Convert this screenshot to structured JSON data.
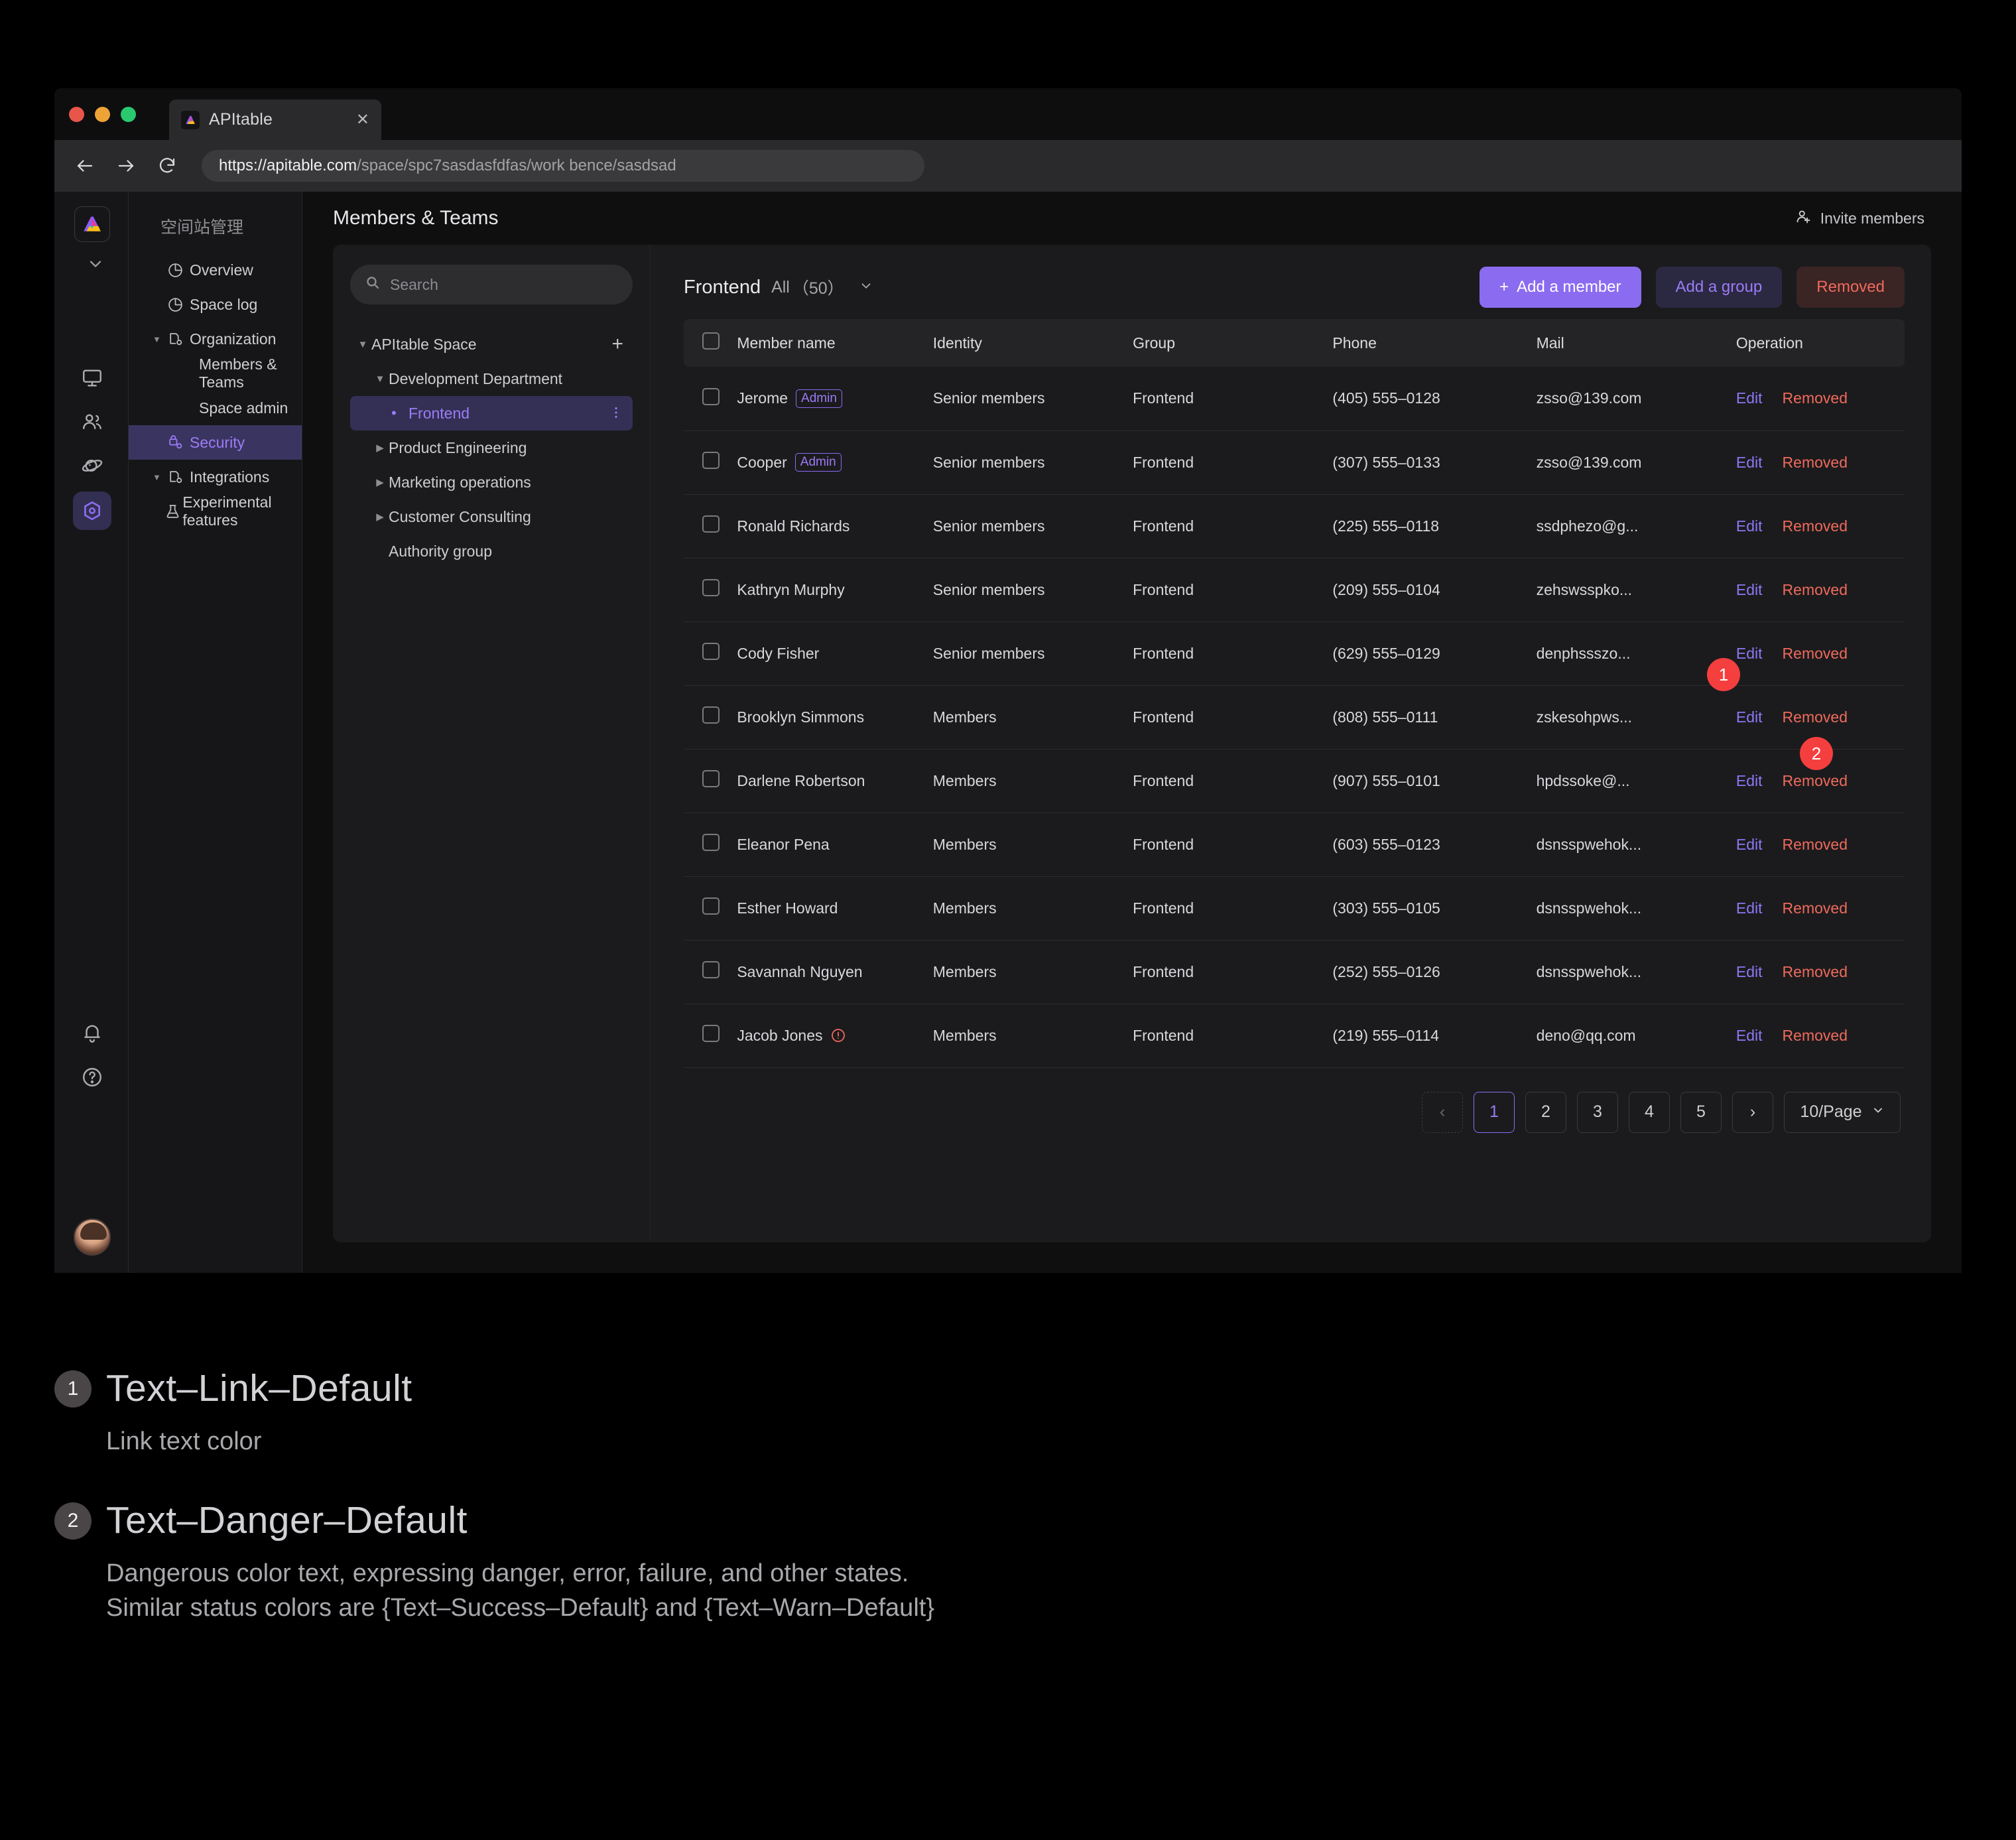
{
  "browser": {
    "tab_title": "APItable",
    "tab_close": "✕",
    "url_strong": "https://apitable.com",
    "url_rest": "/space/spc7sasdasfdfas/work bence/sasdsad"
  },
  "rail": {
    "items": [
      {
        "name": "monitor-icon"
      },
      {
        "name": "people-icon"
      },
      {
        "name": "planet-icon"
      },
      {
        "name": "settings-hex-icon",
        "active": true
      }
    ],
    "bottom": [
      {
        "name": "bell-icon"
      },
      {
        "name": "help-icon"
      }
    ]
  },
  "nav": {
    "heading": "空间站管理",
    "items": [
      {
        "label": "Overview",
        "icon": "pie-chart-icon",
        "level": 0,
        "caret": "",
        "active": false
      },
      {
        "label": "Space log",
        "icon": "pie-chart-icon",
        "level": 0,
        "caret": "",
        "active": false
      },
      {
        "label": "Organization",
        "icon": "org-icon",
        "level": 0,
        "caret": "▼",
        "active": false
      },
      {
        "label": "Members & Teams",
        "icon": "",
        "level": 1,
        "caret": "",
        "active": false
      },
      {
        "label": "Space admin",
        "icon": "",
        "level": 1,
        "caret": "",
        "active": false
      },
      {
        "label": "Security",
        "icon": "lock-icon",
        "level": 0,
        "caret": "",
        "active": true
      },
      {
        "label": "Integrations",
        "icon": "org-icon",
        "level": 0,
        "caret": "▼",
        "active": false
      },
      {
        "label": "Experimental features",
        "icon": "flask-icon",
        "level": 0,
        "caret": "",
        "active": false
      }
    ]
  },
  "header": {
    "title": "Members & Teams",
    "invite_label": "Invite members"
  },
  "tree": {
    "search_placeholder": "Search",
    "nodes": [
      {
        "label": "APItable Space",
        "level": 1,
        "caret": "▼",
        "selected": false,
        "plus": "+"
      },
      {
        "label": "Development Department",
        "level": 2,
        "caret": "▼",
        "selected": false
      },
      {
        "label": "Frontend",
        "level": 3,
        "caret": "",
        "selected": true,
        "bullet": "•",
        "menu": "⋮"
      },
      {
        "label": "Product Engineering",
        "level": 2,
        "caret": "▶",
        "selected": false
      },
      {
        "label": "Marketing operations",
        "level": 2,
        "caret": "▶",
        "selected": false
      },
      {
        "label": "Customer Consulting",
        "level": 2,
        "caret": "▶",
        "selected": false
      },
      {
        "label": "Authority group",
        "level": 2,
        "caret": "",
        "selected": false
      }
    ]
  },
  "main": {
    "group_name": "Frontend",
    "group_scope": "All",
    "group_count": "（50）",
    "caret": "⌄",
    "buttons": {
      "add_member": "Add a member",
      "add_member_plus": "+",
      "add_group": "Add a group",
      "removed": "Removed"
    },
    "columns": [
      "Member name",
      "Identity",
      "Group",
      "Phone",
      "Mail",
      "Operation"
    ],
    "rows": [
      {
        "name": "Jerome",
        "badge": "Admin",
        "warn": false,
        "identity": "Senior members",
        "group": "Frontend",
        "phone": "(405) 555–0128",
        "mail": "zsso@139.com",
        "edit": "Edit",
        "removed": "Removed"
      },
      {
        "name": "Cooper",
        "badge": "Admin",
        "warn": false,
        "identity": "Senior members",
        "group": "Frontend",
        "phone": "(307) 555–0133",
        "mail": "zsso@139.com",
        "edit": "Edit",
        "removed": "Removed"
      },
      {
        "name": "Ronald Richards",
        "badge": "",
        "warn": false,
        "identity": "Senior members",
        "group": "Frontend",
        "phone": "(225) 555–0118",
        "mail": "ssdphezo@g...",
        "edit": "Edit",
        "removed": "Removed"
      },
      {
        "name": "Kathryn Murphy",
        "badge": "",
        "warn": false,
        "identity": "Senior members",
        "group": "Frontend",
        "phone": "(209) 555–0104",
        "mail": "zehswsspko...",
        "edit": "Edit",
        "removed": "Removed"
      },
      {
        "name": "Cody Fisher",
        "badge": "",
        "warn": false,
        "identity": "Senior members",
        "group": "Frontend",
        "phone": "(629) 555–0129",
        "mail": "denphssszo...",
        "edit": "Edit",
        "removed": "Removed"
      },
      {
        "name": "Brooklyn Simmons",
        "badge": "",
        "warn": false,
        "identity": "Members",
        "group": "Frontend",
        "phone": "(808) 555–0111",
        "mail": "zskesohpws...",
        "edit": "Edit",
        "removed": "Removed"
      },
      {
        "name": "Darlene Robertson",
        "badge": "",
        "warn": false,
        "identity": "Members",
        "group": "Frontend",
        "phone": "(907) 555–0101",
        "mail": "hpdssoke@...",
        "edit": "Edit",
        "removed": "Removed"
      },
      {
        "name": "Eleanor Pena",
        "badge": "",
        "warn": false,
        "identity": "Members",
        "group": "Frontend",
        "phone": "(603) 555–0123",
        "mail": "dsnsspwehok...",
        "edit": "Edit",
        "removed": "Removed"
      },
      {
        "name": "Esther Howard",
        "badge": "",
        "warn": false,
        "identity": "Members",
        "group": "Frontend",
        "phone": "(303) 555–0105",
        "mail": "dsnsspwehok...",
        "edit": "Edit",
        "removed": "Removed"
      },
      {
        "name": "Savannah Nguyen",
        "badge": "",
        "warn": false,
        "identity": "Members",
        "group": "Frontend",
        "phone": "(252) 555–0126",
        "mail": "dsnsspwehok...",
        "edit": "Edit",
        "removed": "Removed"
      },
      {
        "name": "Jacob Jones",
        "badge": "",
        "warn": true,
        "identity": "Members",
        "group": "Frontend",
        "phone": "(219) 555–0114",
        "mail": "deno@qq.com",
        "edit": "Edit",
        "removed": "Removed"
      }
    ],
    "pagination": {
      "prev": "‹",
      "pages": [
        "1",
        "2",
        "3",
        "4",
        "5"
      ],
      "current": "1",
      "next": "›",
      "page_size": "10/Page",
      "page_size_caret": "⌄"
    }
  },
  "markers": [
    {
      "num": "1"
    },
    {
      "num": "2"
    }
  ],
  "legend": [
    {
      "num": "1",
      "title": "Text–Link–Default",
      "body": "Link text color"
    },
    {
      "num": "2",
      "title": "Text–Danger–Default",
      "body": "Dangerous color text, expressing danger, error, failure, and other states.\nSimilar status colors are {Text–Success–Default} and {Text–Warn–Default}"
    }
  ],
  "colors": {
    "link": "#8b78f5",
    "danger": "#ef6a5c",
    "accent": "#8b6cf0",
    "marker": "#f53f3f"
  }
}
